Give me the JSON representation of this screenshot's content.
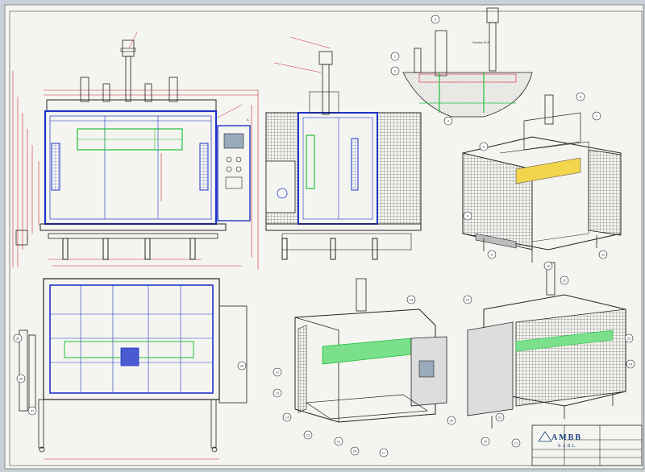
{
  "colors": {
    "background": "#c9cfd8",
    "paper": "#f4f5f1",
    "line": "#2a2a2a",
    "blue": "#2033c8",
    "green": "#1fbf38",
    "red": "#d0202a"
  },
  "callouts": [
    "1",
    "2",
    "3",
    "4",
    "5",
    "6",
    "7",
    "8",
    "9",
    "10",
    "11",
    "12",
    "13",
    "14",
    "15",
    "16",
    "17",
    "18",
    "19",
    "20",
    "21",
    "22",
    "23",
    "24",
    "25",
    "26",
    "27",
    "28",
    "29",
    "30",
    "31"
  ],
  "section_label": "Section B-B",
  "dimension_mark": "A",
  "title_block": {
    "company": "AMBB",
    "company_sub": "SARL"
  }
}
